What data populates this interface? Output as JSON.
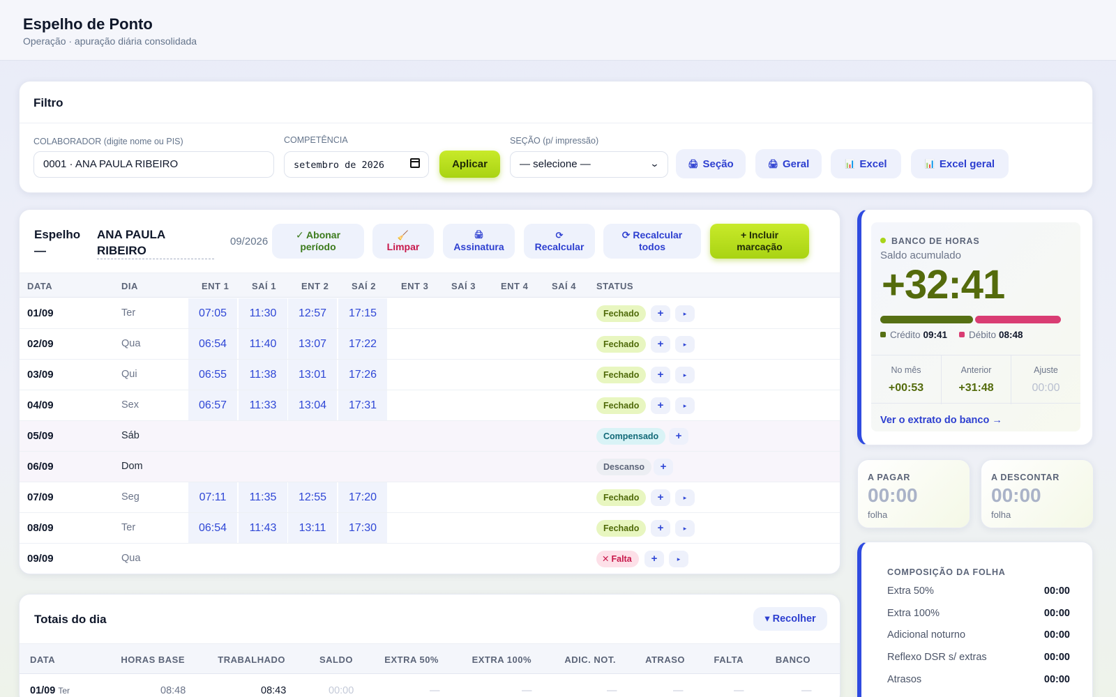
{
  "header": {
    "title": "Espelho de Ponto",
    "subtitle": "Operação · apuração diária consolidada"
  },
  "filter": {
    "title": "Filtro",
    "colaborador_label": "COLABORADOR (digite nome ou PIS)",
    "colaborador_value": "0001 · ANA PAULA RIBEIRO",
    "competencia_label": "COMPETÊNCIA",
    "competencia_value": "setembro de 2026",
    "apply_label": "Aplicar",
    "secao_label": "SEÇÃO (p/ impressão)",
    "secao_value": "— selecione —",
    "btn_secao": "Seção",
    "btn_geral": "Geral",
    "btn_excel": "Excel",
    "btn_excel_geral": "Excel geral"
  },
  "espelho": {
    "title": "Espelho —",
    "name": "ANA PAULA RIBEIRO",
    "competencia": "09/2026",
    "btn_abonar": "✓ Abonar período",
    "btn_limpar": "Limpar",
    "btn_assinatura": "Assinatura",
    "btn_recalcular": "Recalcular",
    "btn_recalcular_todos": "Recalcular todos",
    "btn_incluir": "+ Incluir marcação",
    "columns": [
      "DATA",
      "DIA",
      "ENT 1",
      "SAÍ 1",
      "ENT 2",
      "SAÍ 2",
      "ENT 3",
      "SAÍ 3",
      "ENT 4",
      "SAÍ 4",
      "STATUS"
    ],
    "rows": [
      {
        "date": "01/09",
        "dia": "Ter",
        "p": [
          "07:05",
          "11:30",
          "12:57",
          "17:15"
        ],
        "status": "Fechado"
      },
      {
        "date": "02/09",
        "dia": "Qua",
        "p": [
          "06:54",
          "11:40",
          "13:07",
          "17:22"
        ],
        "status": "Fechado"
      },
      {
        "date": "03/09",
        "dia": "Qui",
        "p": [
          "06:55",
          "11:38",
          "13:01",
          "17:26"
        ],
        "status": "Fechado"
      },
      {
        "date": "04/09",
        "dia": "Sex",
        "p": [
          "06:57",
          "11:33",
          "13:04",
          "17:31"
        ],
        "status": "Fechado"
      },
      {
        "date": "05/09",
        "dia": "Sáb",
        "p": [],
        "status": "Compensado"
      },
      {
        "date": "06/09",
        "dia": "Dom",
        "p": [],
        "status": "Descanso"
      },
      {
        "date": "07/09",
        "dia": "Seg",
        "p": [
          "07:11",
          "11:35",
          "12:55",
          "17:20"
        ],
        "status": "Fechado"
      },
      {
        "date": "08/09",
        "dia": "Ter",
        "p": [
          "06:54",
          "11:43",
          "13:11",
          "17:30"
        ],
        "status": "Fechado"
      },
      {
        "date": "09/09",
        "dia": "Qua",
        "p": [],
        "status": "Falta"
      }
    ],
    "add_symbol": "+",
    "play_symbol": "▸"
  },
  "totais": {
    "title": "Totais do dia",
    "recolher": "▾ Recolher",
    "columns": [
      "DATA",
      "HORAS BASE",
      "TRABALHADO",
      "SALDO",
      "EXTRA 50%",
      "EXTRA 100%",
      "ADIC. NOT.",
      "ATRASO",
      "FALTA",
      "BANCO"
    ],
    "first_row": {
      "date": "01/09",
      "dia": "Ter",
      "base": "08:48",
      "trabalhado": "08:43",
      "saldo": "00:00",
      "dash": "—"
    }
  },
  "banco": {
    "label": "BANCO DE HORAS",
    "sub": "Saldo acumulado",
    "saldo": "+32:41",
    "credito_label": "Crédito",
    "credito": "09:41",
    "debito_label": "Débito",
    "debito": "08:48",
    "credito_fraction": 0.52,
    "no_mes_label": "No mês",
    "no_mes": "+00:53",
    "anterior_label": "Anterior",
    "anterior": "+31:48",
    "ajuste_label": "Ajuste",
    "ajuste": "00:00",
    "extrato": "Ver o extrato do banco →",
    "accent": "#2f4be0"
  },
  "pagar": {
    "label": "A PAGAR",
    "value": "00:00",
    "sub": "folha"
  },
  "descontar": {
    "label": "A DESCONTAR",
    "value": "00:00",
    "sub": "folha"
  },
  "folha": {
    "title": "COMPOSIÇÃO DA FOLHA",
    "items": [
      {
        "label": "Extra 50%",
        "value": "00:00"
      },
      {
        "label": "Extra 100%",
        "value": "00:00"
      },
      {
        "label": "Adicional noturno",
        "value": "00:00"
      },
      {
        "label": "Reflexo DSR s/ extras",
        "value": "00:00"
      },
      {
        "label": "Atrasos",
        "value": "00:00"
      }
    ]
  }
}
